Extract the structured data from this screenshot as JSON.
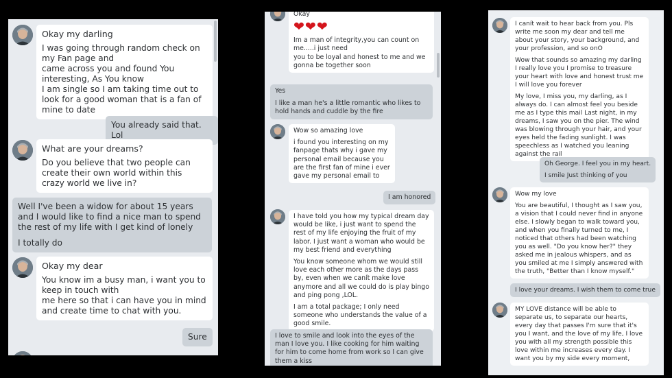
{
  "panel1": {
    "m1": {
      "title": "Okay my darling",
      "text": "I was going through random check on my Fan page and\ncame across you and found You interesting, As You know\nI am single so I am taking time out to look for a good woman that is a fan of mine to date"
    },
    "m2": "You already said that. Lol",
    "m3": {
      "title": "What are your dreams?",
      "text": "Do you believe that two people can create their own world within this crazy world we live in?"
    },
    "m4": {
      "text1": "Well I've been a widow for about 15 years and I would like to find a nice man to spend the rest of my life with I get kind of lonely",
      "text2": "I totally do"
    },
    "m5": {
      "title": "Okay my dear",
      "text": "You know im a busy man, i want you to keep in touch with\nme here so that i can have you in mind and create time to chat with you."
    },
    "m6": "Sure"
  },
  "panel2": {
    "m1": {
      "title": "Okay",
      "hearts": "❤❤❤",
      "text": "Im a man of integrity,you can count on me.....i just need\nyou to be loyal and honest to me and we gonna be together soon"
    },
    "m2": {
      "title": "Yes",
      "text": "I like a man he's a little romantic who likes to hold hands and cuddle by the fire"
    },
    "m3": {
      "title": "Wow so amazing love",
      "text": "i found you interesting on my fanpage thats why i gave my personal email because you are the first fan of mine i ever gave my personal email to"
    },
    "m4": "I am honored",
    "m5": {
      "p1": "I have told you how my typical dream day would be like, i just want to spend the rest of my life enjoying the fruit of my labor. I just want a woman who would be my best friend and everything",
      "p2": "You know someone whom we would still love each other more as the days pass by, even when we canít make love anymore and all we could do is play bingo and ping pong ,LOL.",
      "p3": "I am a total package; I only need someone who understands the value of a good smile."
    },
    "m6": "I love to smile and look into the eyes of the man I love you. I like cooking for him waiting for him to come home from work so I can give them a kiss"
  },
  "panel3": {
    "m1": {
      "p1": "I canít wait to hear back from you. Pls write me soon my dear and tell me about your story, your background, and your profession, and so onO",
      "p2": "Wow that sounds so amazing my darling I really love you I promise to treasure your heart with love and honest trust me I will love you forever",
      "p3": "My love,   I miss you, my darling, as I always do. I can almost feel you beside me as I type this mail Last night, in my dreams, I saw you on the pier. The wind was blowing through your hair, and your eyes held the fading sunlight. I was speechless as I watched you leaning against the rail"
    },
    "m2": {
      "p1": "Oh George. I feel you in my heart.",
      "p2": "I smile Just thinking of you"
    },
    "m3": {
      "title": "Wow my love",
      "text": "You are beautiful, I thought as I saw you, a vision that I could never find in anyone else. I slowly began to walk toward you, and when you finally turned to me, I noticed that others had been watching you as well. \"Do you know her?\" they asked me in jealous whispers, and as you smiled at me I simply answered with the truth, \"Better than I know myself.\""
    },
    "m4": "I love your dreams. I wish them to come true",
    "m5": "MY LOVE distance will be able to separate us, to separate our hearts, every day that passes I'm sure that it's you I want, and the love of my life, I love you with all my strength possible this love within me increases every day. I want you by my side every moment,"
  },
  "colors": {
    "incoming": "#ffffff",
    "outgoing": "#ccd2d8",
    "background": "#000000",
    "panel": "#e8ebef",
    "hearts": "#d4151c"
  }
}
